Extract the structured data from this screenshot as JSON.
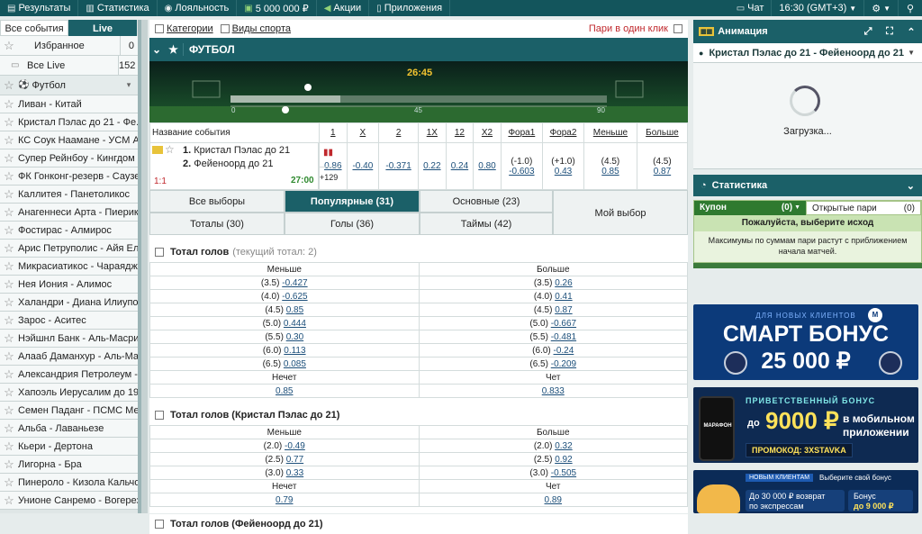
{
  "topbar": {
    "results": "Результаты",
    "stats": "Статистика",
    "loyalty": "Лояльность",
    "amount": "5 000 000 ₽",
    "promo": "Акции",
    "apps": "Приложения",
    "chat": "Чат",
    "time": "16:30 (GMT+3)"
  },
  "left": {
    "tab_all": "Все события",
    "tab_live": "Live",
    "favorites": "Избранное",
    "favorites_count": "0",
    "all_live": "Все Live",
    "all_live_count": "152",
    "football": "Футбол",
    "matches": [
      "Ливан - Китай",
      "Кристал Пэлас до 21 - Фе...",
      "КС Соук Наамане - УСМ А...",
      "Супер Рейнбоу - Кингдом ...",
      "ФК Гонконг-резерв - Саузе...",
      "Каллитея - Панетоликос",
      "Анагеннеси Арта - Пиерикос",
      "Фостирас - Алмирос",
      "Арис Петруполис - Айя Ел...",
      "Микрасиатикос - Чараядж...",
      "Нея Иония - Алимос",
      "Халандри - Диана Илиуполи",
      "Зарос - Аситес",
      "Нэйшнл Банк - Аль-Масри",
      "Алааб Даманхур - Аль-Ма...",
      "Александрия Петролеум - ...",
      "Хапоэль Иерусалим до 19...",
      "Семен Паданг - ПСМС Ме...",
      "Альба - Лаваньезе",
      "Кьери - Дертона",
      "Лигорна - Бра",
      "Пинероло - Кизола Кальчо",
      "Унионе Санремо - Вогерезе"
    ]
  },
  "main": {
    "filter_categories": "Категории",
    "filter_sports": "Виды спорта",
    "one_click": "Пари в один клик",
    "sport_title": "ФУТБОЛ",
    "timer": "26:45",
    "ruler": [
      "0",
      "45",
      "90"
    ],
    "event_header": "Название события",
    "cols": [
      "1",
      "X",
      "2",
      "1X",
      "12",
      "X2",
      "Фора1",
      "Фора2",
      "Меньше",
      "Больше"
    ],
    "team1": "Кристал Пэлас до 21",
    "team2": "Фейеноорд до 21",
    "score": "1:1",
    "time": "27:00",
    "more": "+129",
    "odds": [
      "0.86",
      "-0.40",
      "-0.371",
      "0.22",
      "0.24",
      "0.80"
    ],
    "fora1_h": "(-1.0)",
    "fora1_o": "-0.603",
    "fora2_h": "(+1.0)",
    "fora2_o": "0.43",
    "under_h": "(4.5)",
    "under_o": "0.85",
    "over_h": "(4.5)",
    "over_o": "0.87",
    "tabs": {
      "all": "Все выборы",
      "popular": "Популярные (31)",
      "main": "Основные (23)",
      "totals": "Тоталы (30)",
      "goals": "Голы (36)",
      "timed": "Таймы (42)",
      "mine": "Мой выбор"
    },
    "m1": {
      "title": "Тотал голов",
      "note": "(текущий тотал: 2)",
      "left": "Меньше",
      "right": "Больше",
      "rows": [
        [
          "(3.5)",
          "-0.427",
          "(3.5)",
          "0.26"
        ],
        [
          "(4.0)",
          "-0.625",
          "(4.0)",
          "0.41"
        ],
        [
          "(4.5)",
          "0.85",
          "(4.5)",
          "0.87"
        ],
        [
          "(5.0)",
          "0.444",
          "(5.0)",
          "-0.667"
        ],
        [
          "(5.5)",
          "0.30",
          "(5.5)",
          "-0.481"
        ],
        [
          "(6.0)",
          "0.113",
          "(6.0)",
          "-0.24"
        ],
        [
          "(6.5)",
          "0.085",
          "(6.5)",
          "-0.209"
        ]
      ],
      "odd": "Нечет",
      "even": "Чет",
      "odd_v": "0.85",
      "even_v": "0.833"
    },
    "m2": {
      "title": "Тотал голов (Кристал Пэлас до 21)",
      "left": "Меньше",
      "right": "Больше",
      "rows": [
        [
          "(2.0)",
          "-0.49",
          "(2.0)",
          "0.32"
        ],
        [
          "(2.5)",
          "0.77",
          "(2.5)",
          "0.92"
        ],
        [
          "(3.0)",
          "0.33",
          "(3.0)",
          "-0.505"
        ]
      ],
      "odd": "Нечет",
      "even": "Чет",
      "odd_v": "0.79",
      "even_v": "0.89"
    },
    "m3": {
      "title": "Тотал голов (Фейеноорд до 21)"
    }
  },
  "right": {
    "anim_title": "Анимация",
    "match": "Кристал Пэлас до 21 - Фейеноорд до 21",
    "loading": "Загрузка...",
    "stats": "Статистика",
    "coupon": "Купон",
    "coupon_count": "(0)",
    "open_bets": "Открытые пари",
    "open_count": "(0)",
    "choose": "Пожалуйста, выберите исход",
    "info": "Максимумы по суммам пари растут с приближением начала матчей.",
    "b1_small": "ДЛЯ НОВЫХ КЛИЕНТОВ",
    "b1_big1": "СМАРТ БОНУС",
    "b1_big2": "25 000 ₽",
    "b2_small": "ПРИВЕТСТВЕННЫЙ БОНУС",
    "b2_pre": "до",
    "b2_amt": "9000 ₽",
    "b2_txt1": "в мобильном",
    "b2_txt2": "приложении",
    "b2_code": "ПРОМОКОД: 3XSTAVKA",
    "b2_logo": "МАРАФОН",
    "b3_tag": "НОВЫМ КЛИЕНТАМ",
    "b3_choose": "Выберите свой бонус",
    "b3_l1": "До 30 000 ₽ возврат",
    "b3_l2": "по экспрессам",
    "b3_r1": "Бонус",
    "b3_r2": "до 9 000 ₽"
  },
  "colors": {
    "teal": "#1b6068",
    "dark": "#13555c",
    "link": "#1c4f7a"
  }
}
